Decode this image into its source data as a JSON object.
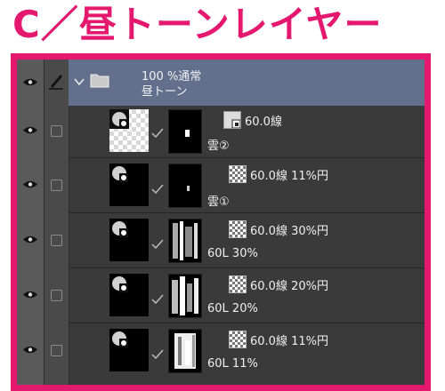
{
  "heading": "C／昼トーンレイヤー",
  "colors": {
    "accent": "#e4186f",
    "panel": "#3a3a3a",
    "selected": "#62708e"
  },
  "folder": {
    "opacity_mode": "100 %通常",
    "name": "昼トーン",
    "icons": [
      "eye-icon",
      "pen-icon",
      "chevron-down-icon",
      "folder-icon"
    ]
  },
  "layers": [
    {
      "tone_label": "60.0線",
      "name": "雲②"
    },
    {
      "tone_label": "60.0線 11%円",
      "name": "雲①"
    },
    {
      "tone_label": "60.0線 30%円",
      "name": "60L 30%"
    },
    {
      "tone_label": "60.0線 20%円",
      "name": "60L 20%"
    },
    {
      "tone_label": "60.0線 11%円",
      "name": "60L 11%"
    }
  ]
}
